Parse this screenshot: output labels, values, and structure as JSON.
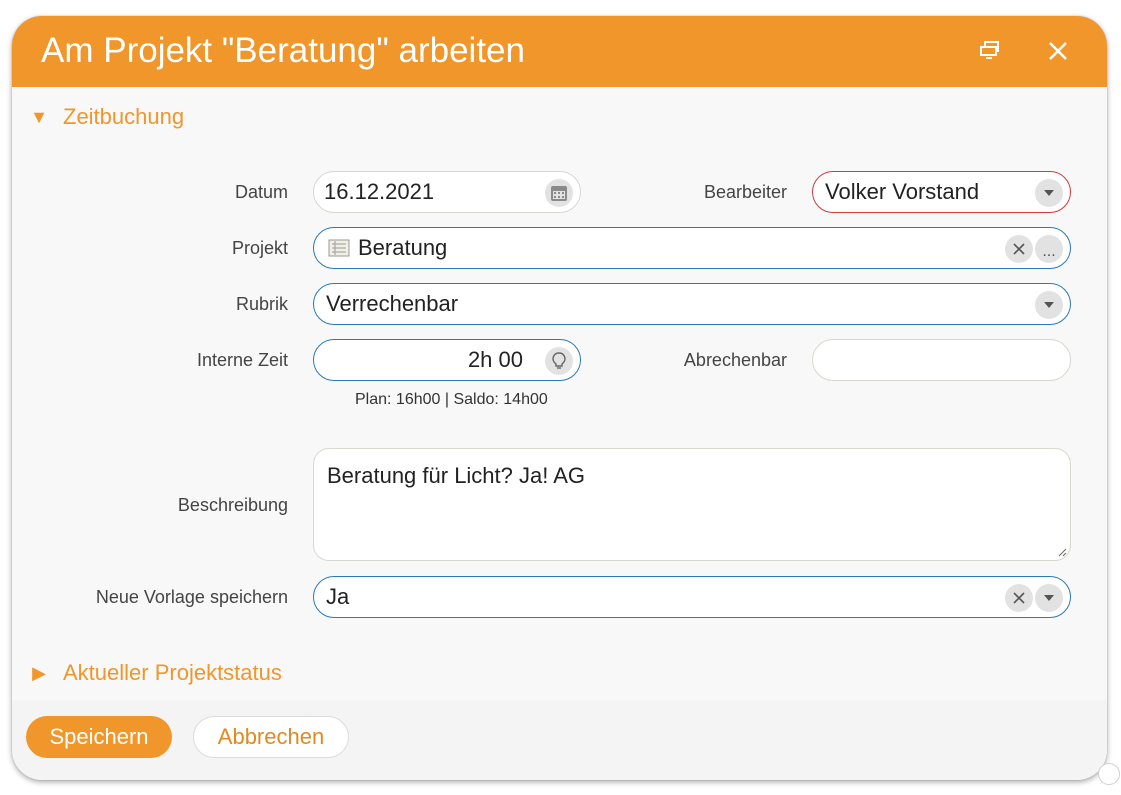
{
  "window": {
    "title": "Am Projekt \"Beratung\" arbeiten",
    "accent_color": "#f0962a"
  },
  "sections": {
    "zeitbuchung": {
      "label": "Zeitbuchung",
      "expanded": true
    },
    "projektstatus": {
      "label": "Aktueller Projektstatus",
      "expanded": false
    }
  },
  "form": {
    "datum": {
      "label": "Datum",
      "value": "16.12.2021"
    },
    "bearbeiter": {
      "label": "Bearbeiter",
      "value": "Volker Vorstand"
    },
    "projekt": {
      "label": "Projekt",
      "value": "Beratung",
      "more": "..."
    },
    "rubrik": {
      "label": "Rubrik",
      "value": "Verrechenbar"
    },
    "interne_zeit": {
      "label": "Interne Zeit",
      "value": "2h 00"
    },
    "abrechenbar": {
      "label": "Abrechenbar",
      "value": ""
    },
    "hint": "Plan: 16h00  |  Saldo: 14h00",
    "beschreibung": {
      "label": "Beschreibung",
      "value": "Beratung für Licht? Ja! AG"
    },
    "vorlage": {
      "label": "Neue Vorlage speichern",
      "value": "Ja"
    }
  },
  "buttons": {
    "save": "Speichern",
    "cancel": "Abbrechen"
  },
  "icons": [
    "restore-icon",
    "close-icon",
    "triangle-down-icon",
    "triangle-right-icon",
    "calendar-icon",
    "chevron-down-icon",
    "list-icon",
    "clear-icon",
    "lightbulb-icon"
  ]
}
